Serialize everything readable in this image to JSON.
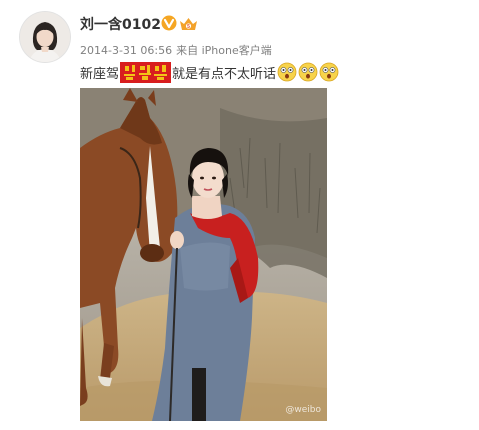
{
  "post": {
    "username": "刘一含0102",
    "time": "2014-3-31 06:56",
    "source": "来自 iPhone客户端",
    "text_before": "新座驾",
    "text_after": "就是有点不太听话",
    "emojis": [
      "shocked-face-icon",
      "shocked-face-icon",
      "shocked-face-icon"
    ]
  },
  "colors": {
    "username": "#333333",
    "meta": "#808080",
    "verified_badge": "#f5a623",
    "redaction": "#d81e1e"
  },
  "photo": {
    "description_icon": "photo-woman-with-horse"
  }
}
